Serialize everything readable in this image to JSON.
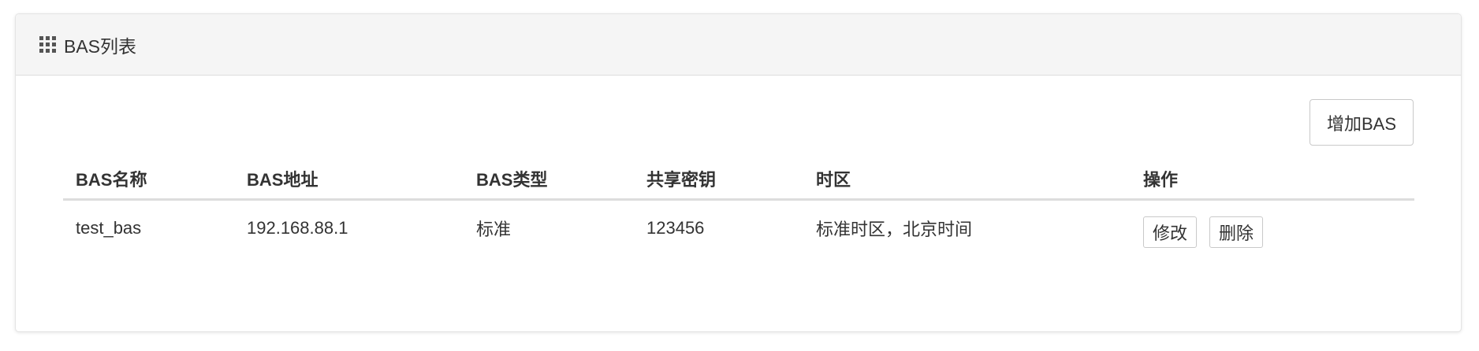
{
  "panel": {
    "title": "BAS列表",
    "icon": "grid-icon"
  },
  "toolbar": {
    "add_label": "增加BAS"
  },
  "table": {
    "columns": [
      "BAS名称",
      "BAS地址",
      "BAS类型",
      "共享密钥",
      "时区",
      "操作"
    ],
    "rows": [
      {
        "name": "test_bas",
        "address": "192.168.88.1",
        "type": "标准",
        "secret": "123456",
        "timezone": "标准时区，北京时间",
        "actions": {
          "edit_label": "修改",
          "delete_label": "删除"
        }
      }
    ]
  }
}
